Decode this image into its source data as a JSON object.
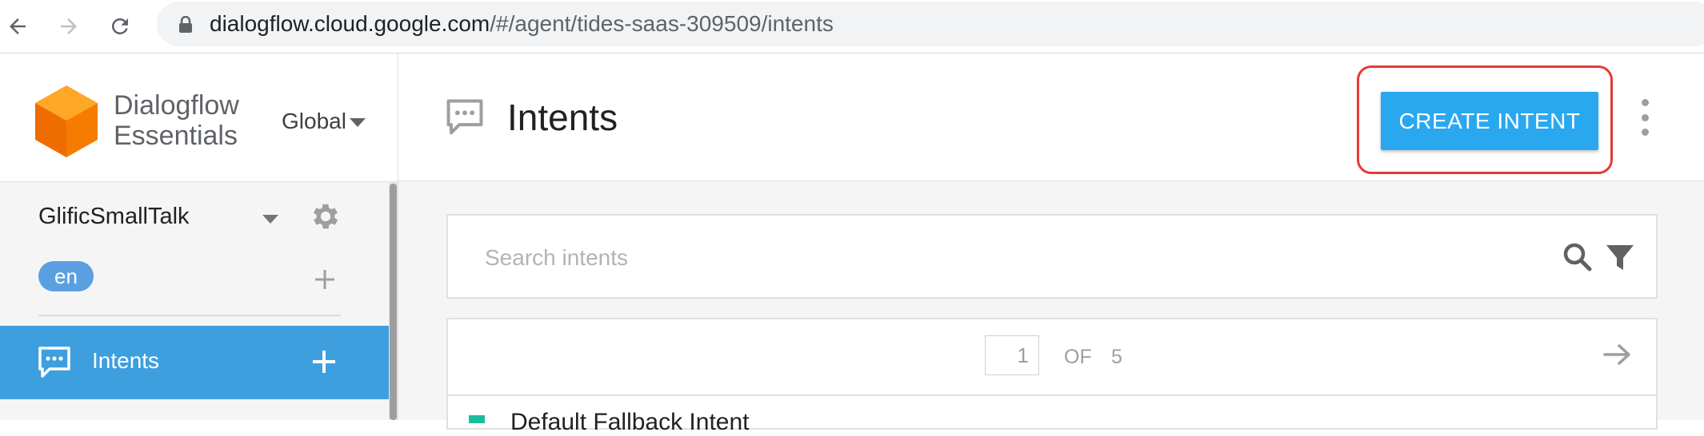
{
  "browser": {
    "url_host": "dialogflow.cloud.google.com",
    "url_path": "/#/agent/tides-saas-309509/intents",
    "icons": [
      "back-arrow-icon",
      "forward-arrow-icon",
      "reload-icon",
      "lock-icon"
    ]
  },
  "sidebar": {
    "brand_line1": "Dialogflow",
    "brand_line2": "Essentials",
    "region": "Global",
    "agent_name": "GlificSmallTalk",
    "language": "en",
    "nav_items": [
      {
        "label": "Intents",
        "active": true
      }
    ]
  },
  "header": {
    "title": "Intents",
    "create_button": "CREATE INTENT"
  },
  "search": {
    "placeholder": "Search intents"
  },
  "pagination": {
    "current_page": "1",
    "of_label": "OF",
    "total_pages": "5"
  },
  "list": {
    "partial_row": "Default Fallback Intent"
  },
  "colors": {
    "accent_blue": "#29a8f0",
    "sidebar_active": "#3e9fdf",
    "highlight_red": "#e53935",
    "logo_orange": "#f57c00"
  }
}
